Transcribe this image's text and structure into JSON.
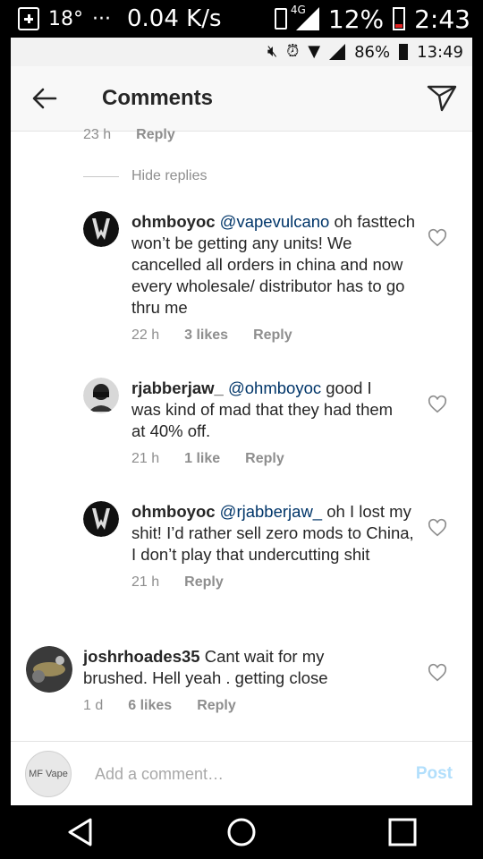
{
  "outer_status": {
    "temp": "18°",
    "dots": "···",
    "speed": "0.04 K/s",
    "net": "4G",
    "battery": "12%",
    "time": "2:43"
  },
  "inner_status": {
    "battery": "86%",
    "time": "13:49"
  },
  "header": {
    "title": "Comments"
  },
  "top_meta": {
    "time": "23 h",
    "reply": "Reply"
  },
  "hide_replies": "Hide replies",
  "comments": [
    {
      "user": "ohmboyoc",
      "mention": "@vapevulcano",
      "text": " oh fasttech won’t be getting any units! We cancelled all orders in china and now every wholesale/ distributor has to go thru me",
      "time": "22 h",
      "likes": "3 likes",
      "reply": "Reply"
    },
    {
      "user": "rjabberjaw_",
      "mention": "@ohmboyoc",
      "text": " good I was kind of mad that they had them at 40% off.",
      "time": "21 h",
      "likes": "1 like",
      "reply": "Reply"
    },
    {
      "user": "ohmboyoc",
      "mention": "@rjabberjaw_",
      "text": " oh I lost my shit! I’d rather sell zero mods to China, I don’t play that undercutting shit",
      "time": "21 h",
      "likes": "",
      "reply": "Reply"
    },
    {
      "user": "joshrhoades35",
      "mention": "",
      "text": " Cant wait for my brushed. Hell yeah . getting close",
      "time": "1 d",
      "likes": "6 likes",
      "reply": "Reply"
    }
  ],
  "composer": {
    "placeholder": "Add a comment…",
    "post": "Post",
    "avatar_text": "MF Vape"
  },
  "icons": {
    "back": "back-arrow-icon",
    "send": "send-icon",
    "heart": "heart-icon"
  },
  "colors": {
    "mention": "#003569",
    "meta": "#8e8e8e",
    "post": "#b2dffc"
  }
}
